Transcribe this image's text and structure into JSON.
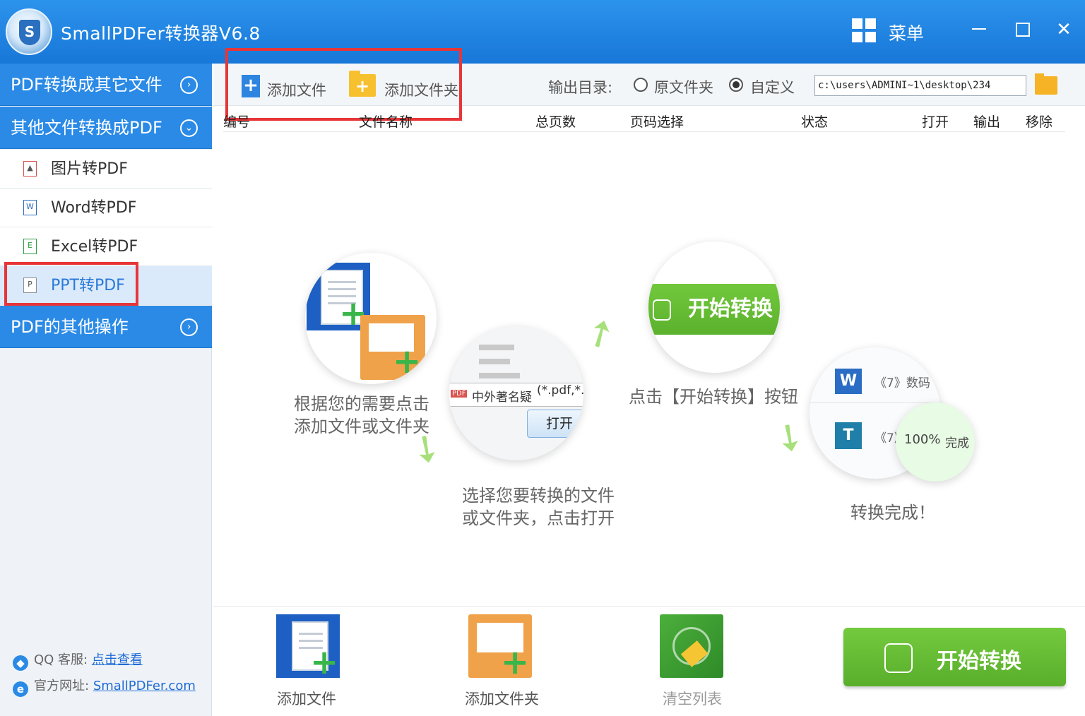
{
  "window": {
    "title": "SmallPDFer转换器V6.8",
    "menu_label": "菜单",
    "minimize": "—",
    "close": "✕"
  },
  "sidebar": {
    "groups": [
      {
        "label": "PDF转换成其它文件",
        "expanded": false
      },
      {
        "label": "其他文件转换成PDF",
        "expanded": true
      },
      {
        "label": "PDF的其他操作",
        "expanded": false
      }
    ],
    "items": [
      {
        "label": "图片转PDF",
        "icon": "image-icon"
      },
      {
        "label": "Word转PDF",
        "icon": "word-icon"
      },
      {
        "label": "Excel转PDF",
        "icon": "excel-icon"
      },
      {
        "label": "PPT转PDF",
        "icon": "ppt-icon",
        "selected": true
      }
    ],
    "contact": {
      "qq_prefix": "QQ 客服:",
      "qq_link": "点击查看",
      "site_prefix": "官方网址:",
      "site_link": "SmallPDFer.com"
    }
  },
  "toolbar": {
    "add_file": "添加文件",
    "add_folder": "添加文件夹",
    "output_label": "输出目录:",
    "radio_source": "原文件夹",
    "radio_custom": "自定义",
    "selected_output": "自定义",
    "output_path": "c:\\users\\ADMINI~1\\desktop\\234"
  },
  "columns": [
    "编号",
    "文件名称",
    "总页数",
    "页码选择",
    "状态",
    "打开",
    "输出",
    "移除"
  ],
  "guide": {
    "step1": [
      "根据您的需要点击",
      "添加文件或文件夹"
    ],
    "step2": [
      "选择您要转换的文件",
      "或文件夹，点击打开"
    ],
    "step3": "点击【开始转换】按钮",
    "step4": "转换完成！",
    "dialog_file": "中外著名疑",
    "dialog_filter": "(*.pdf,*...",
    "dialog_open": "打开",
    "start_label": "开始转换",
    "result_row1": "《7》数码",
    "result_row2": "《7》",
    "result_progress": "100%",
    "result_status": "完成",
    "pdf_tag": "PDF"
  },
  "bottom": {
    "add_file": "添加文件",
    "add_folder": "添加文件夹",
    "clear_list": "清空列表",
    "start": "开始转换"
  },
  "colors": {
    "title_bar": "#1f84e2",
    "sidebar_header": "#2a8ae6",
    "start_green": "#65bb33",
    "highlight_red": "#e73639"
  }
}
